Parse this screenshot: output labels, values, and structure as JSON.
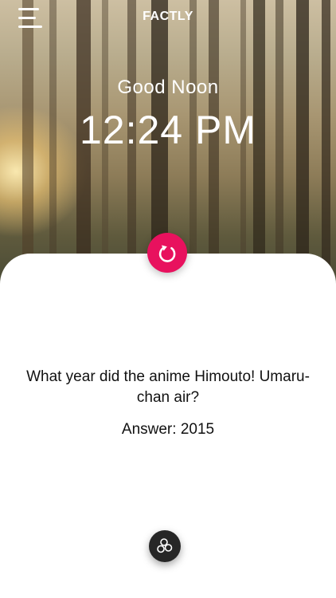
{
  "header": {
    "app_title": "FACTLY",
    "menu_icon": "hamburger-menu-icon"
  },
  "hero": {
    "greeting": "Good Noon",
    "time": "12:24 PM",
    "background": "forest-sunrise-photo"
  },
  "card": {
    "refresh_icon": "refresh-icon",
    "question": "What year did the anime Himouto! Umaru-chan air?",
    "answer_label": "Answer: ",
    "answer_value": "2015",
    "share_icon": "bubbles-icon"
  },
  "colors": {
    "accent": "#e8115e",
    "dark_button": "#262626",
    "text": "#111111",
    "header_text": "#ffffff"
  }
}
